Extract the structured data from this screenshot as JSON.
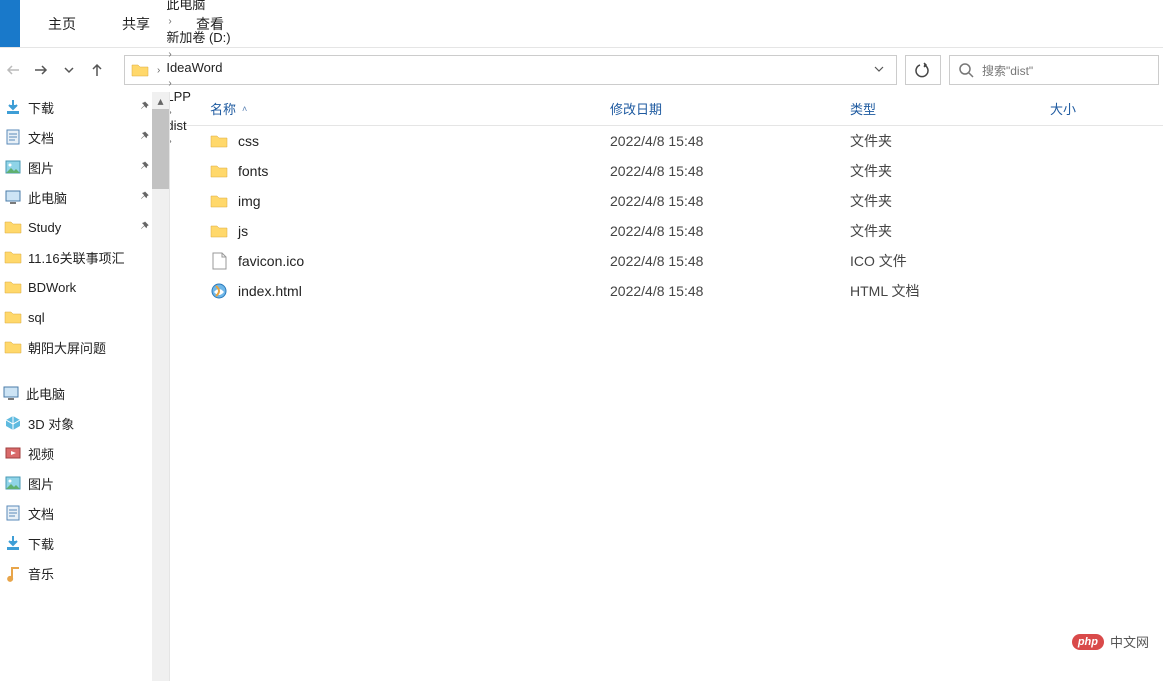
{
  "ribbon": {
    "tabs": [
      "主页",
      "共享",
      "查看"
    ]
  },
  "address": {
    "crumbs": [
      "此电脑",
      "新加卷 (D:)",
      "IdeaWord",
      "LPP",
      "dist"
    ]
  },
  "search": {
    "placeholder": "搜索\"dist\""
  },
  "sidebar": {
    "quick": [
      {
        "label": "下载",
        "icon": "download",
        "pinned": true
      },
      {
        "label": "文档",
        "icon": "document",
        "pinned": true
      },
      {
        "label": "图片",
        "icon": "picture",
        "pinned": true
      },
      {
        "label": "此电脑",
        "icon": "pc",
        "pinned": true
      },
      {
        "label": "Study",
        "icon": "folder",
        "pinned": true
      },
      {
        "label": "11.16关联事项汇",
        "icon": "folder",
        "pinned": false
      },
      {
        "label": "BDWork",
        "icon": "folder",
        "pinned": false
      },
      {
        "label": "sql",
        "icon": "folder",
        "pinned": false
      },
      {
        "label": "朝阳大屏问题",
        "icon": "folder",
        "pinned": false
      }
    ],
    "thispc_label": "此电脑",
    "thispc": [
      {
        "label": "3D 对象",
        "icon": "3d"
      },
      {
        "label": "视频",
        "icon": "video"
      },
      {
        "label": "图片",
        "icon": "picture"
      },
      {
        "label": "文档",
        "icon": "document"
      },
      {
        "label": "下载",
        "icon": "download"
      },
      {
        "label": "音乐",
        "icon": "music"
      }
    ]
  },
  "columns": {
    "name": "名称",
    "date": "修改日期",
    "type": "类型",
    "size": "大小"
  },
  "files": [
    {
      "icon": "folder",
      "name": "css",
      "date": "2022/4/8 15:48",
      "type": "文件夹",
      "size": ""
    },
    {
      "icon": "folder",
      "name": "fonts",
      "date": "2022/4/8 15:48",
      "type": "文件夹",
      "size": ""
    },
    {
      "icon": "folder",
      "name": "img",
      "date": "2022/4/8 15:48",
      "type": "文件夹",
      "size": ""
    },
    {
      "icon": "folder",
      "name": "js",
      "date": "2022/4/8 15:48",
      "type": "文件夹",
      "size": ""
    },
    {
      "icon": "file",
      "name": "favicon.ico",
      "date": "2022/4/8 15:48",
      "type": "ICO 文件",
      "size": ""
    },
    {
      "icon": "html",
      "name": "index.html",
      "date": "2022/4/8 15:48",
      "type": "HTML 文档",
      "size": ""
    }
  ],
  "watermark": {
    "badge": "php",
    "text": "中文网"
  }
}
